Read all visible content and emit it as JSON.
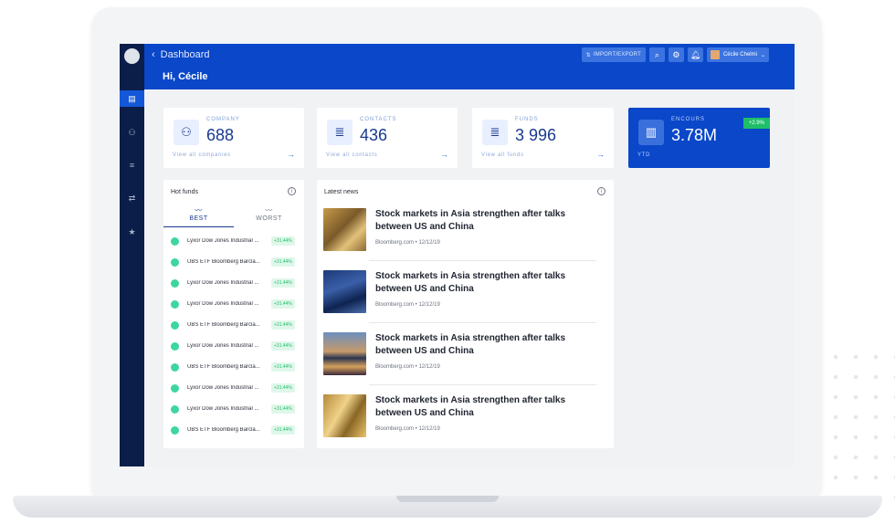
{
  "topbar": {
    "breadcrumb": "Dashboard",
    "greeting": "Hi, Cécile",
    "import_export_label": "IMPORT/EXPORT",
    "user_name": "Cécile Chelmi"
  },
  "sidebar": {
    "items": [
      {
        "icon": "dashboard-icon"
      },
      {
        "icon": "people-icon"
      },
      {
        "icon": "list-icon"
      },
      {
        "icon": "transfer-icon"
      },
      {
        "icon": "star-icon"
      }
    ]
  },
  "stats": {
    "company": {
      "label": "COMPANY",
      "value": "688",
      "link": "View all companies",
      "icon": "people-icon"
    },
    "contacts": {
      "label": "CONTACTS",
      "value": "436",
      "link": "View all contacts",
      "icon": "list-icon"
    },
    "funds": {
      "label": "FUNDS",
      "value": "3 996",
      "link": "View all funds",
      "icon": "list-icon"
    },
    "encours": {
      "label": "ENCOURS",
      "value": "3.78M",
      "sub": "YTD",
      "badge": "+2.9%",
      "icon": "chart-icon"
    }
  },
  "hot_funds": {
    "title": "Hot funds",
    "tabs": [
      "BEST",
      "WORST"
    ],
    "active_tab": "BEST",
    "items": [
      {
        "name": "Lyxor Dow Jones Industrial ...",
        "pct": "+31.44%"
      },
      {
        "name": "UBS ETF Bloomberg Barcla...",
        "pct": "+31.44%"
      },
      {
        "name": "Lyxor Dow Jones Industrial ...",
        "pct": "+31.44%"
      },
      {
        "name": "Lyxor Dow Jones Industrial ...",
        "pct": "+31.44%"
      },
      {
        "name": "UBS ETF Bloomberg Barcla...",
        "pct": "+31.44%"
      },
      {
        "name": "Lyxor Dow Jones Industrial ...",
        "pct": "+31.44%"
      },
      {
        "name": "UBS ETF Bloomberg Barcla...",
        "pct": "+31.44%"
      },
      {
        "name": "Lyxor Dow Jones Industrial ...",
        "pct": "+31.44%"
      },
      {
        "name": "Lyxor Dow Jones Industrial ...",
        "pct": "+31.44%"
      },
      {
        "name": "UBS ETF Bloomberg Barcla...",
        "pct": "+31.44%"
      }
    ]
  },
  "latest_news": {
    "title": "Latest news",
    "items": [
      {
        "headline": "Stock markets in Asia strengthen after talks between US and China",
        "meta": "Bloomberg.com • 12/12/19"
      },
      {
        "headline": "Stock markets in Asia strengthen after talks between US and China",
        "meta": "Bloomberg.com • 12/12/19"
      },
      {
        "headline": "Stock markets in Asia strengthen after talks between US and China",
        "meta": "Bloomberg.com • 12/12/19"
      },
      {
        "headline": "Stock markets in Asia strengthen after talks between US and China",
        "meta": "Bloomberg.com • 12/12/19"
      }
    ]
  },
  "colors": {
    "primary": "#0a47c9",
    "sidebar": "#0b1e4a",
    "positive": "#1fbf6a",
    "accent_text": "#1a3a8f"
  }
}
